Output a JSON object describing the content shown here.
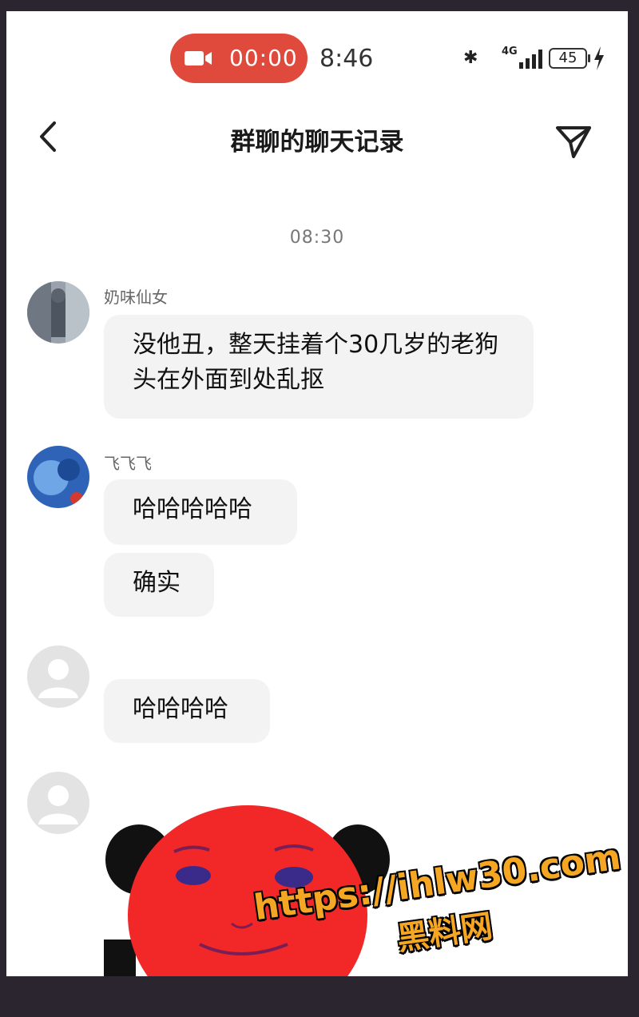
{
  "status_bar": {
    "record_timer": "00:00",
    "clock": "8:46",
    "network": "4G",
    "battery": "45",
    "record_color": "#e04a3d"
  },
  "nav": {
    "title": "群聊的聊天记录"
  },
  "chat": {
    "time_separator": "08:30",
    "messages": [
      {
        "sender": "奶味仙女",
        "bubbles": [
          "没他丑，整天挂着个30几岁的老狗头在外面到处乱抠"
        ]
      },
      {
        "sender": "飞飞飞",
        "bubbles": [
          "哈哈哈哈哈",
          "确实"
        ]
      },
      {
        "sender": "",
        "bubbles": [
          "哈哈哈哈"
        ]
      },
      {
        "sender": "",
        "sticker": "red-panda-face-sticker"
      }
    ]
  },
  "watermark": {
    "url": "https://ihlw30.com",
    "text": "黑料网",
    "color": "#f5a623"
  }
}
